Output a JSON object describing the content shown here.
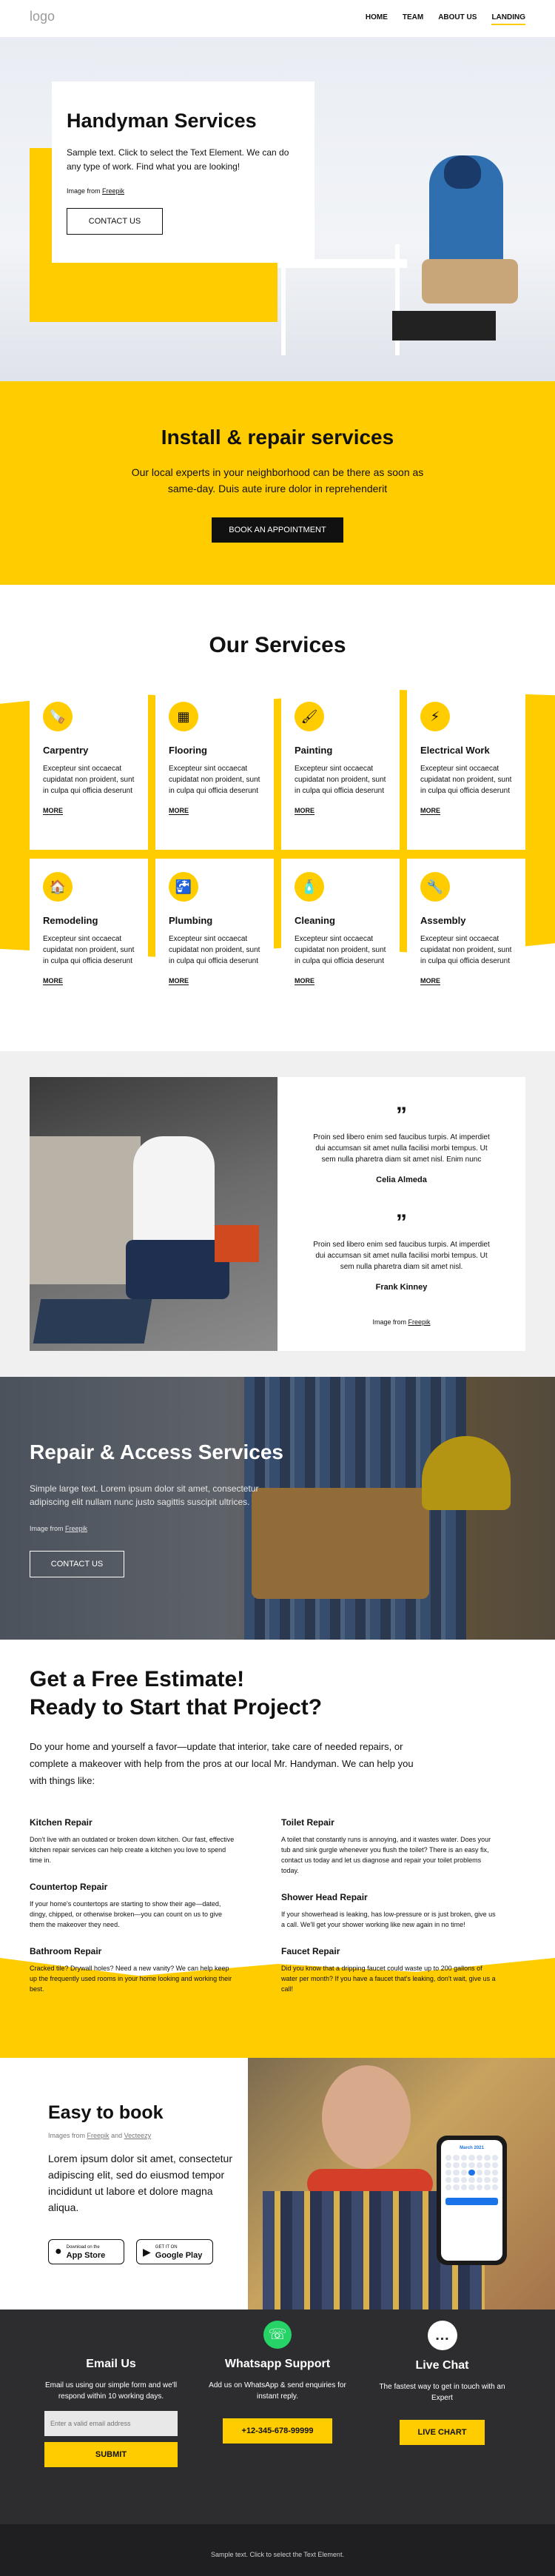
{
  "header": {
    "logo": "logo",
    "nav": [
      "HOME",
      "TEAM",
      "ABOUT US",
      "LANDING"
    ]
  },
  "hero": {
    "title": "Handyman Services",
    "text": "Sample text. Click to select the Text Element. We can do any type of work. Find what you are looking!",
    "image_from": "Image from",
    "freepik": "Freepik",
    "button": "CONTACT US"
  },
  "install": {
    "title": "Install & repair services",
    "text": "Our local experts in your neighborhood can be there as soon as same-day. Duis aute irure dolor in reprehenderit",
    "button": "BOOK AN APPOINTMENT"
  },
  "services": {
    "title": "Our Services",
    "desc": "Excepteur sint occaecat cupidatat non proident, sunt in culpa qui officia deserunt",
    "more": "MORE",
    "items": [
      {
        "name": "Carpentry",
        "icon": "saw-icon",
        "glyph": "🪚"
      },
      {
        "name": "Flooring",
        "icon": "tiles-icon",
        "glyph": "▦"
      },
      {
        "name": "Painting",
        "icon": "paint-roller-icon",
        "glyph": "🖌"
      },
      {
        "name": "Electrical Work",
        "icon": "drill-icon",
        "glyph": "⚡"
      },
      {
        "name": "Remodeling",
        "icon": "house-icon",
        "glyph": "🏠"
      },
      {
        "name": "Plumbing",
        "icon": "faucet-icon",
        "glyph": "🚰"
      },
      {
        "name": "Cleaning",
        "icon": "spray-bottle-icon",
        "glyph": "🧴"
      },
      {
        "name": "Assembly",
        "icon": "tools-icon",
        "glyph": "🔧"
      }
    ]
  },
  "testimonials": {
    "items": [
      {
        "quote": "Proin sed libero enim sed faucibus turpis. At imperdiet dui accumsan sit amet nulla facilisi morbi tempus. Ut sem nulla pharetra diam sit amet nisl. Enim nunc",
        "name": "Celia Almeda"
      },
      {
        "quote": "Proin sed libero enim sed faucibus turpis. At imperdiet dui accumsan sit amet nulla facilisi morbi tempus. Ut sem nulla pharetra diam sit amet nisl.",
        "name": "Frank Kinney"
      }
    ],
    "image_from": "Image from",
    "freepik": "Freepik"
  },
  "repair": {
    "title": "Repair & Access Services",
    "text": "Simple large text. Lorem ipsum dolor sit amet, consectetur adipiscing elit nullam nunc justo sagittis suscipit ultrices.",
    "image_from": "Image from",
    "freepik": "Freepik",
    "button": "CONTACT US"
  },
  "estimate": {
    "title1": "Get a Free Estimate!",
    "title2": "Ready to Start that Project?",
    "intro": "Do your home and yourself a favor—update that interior, take care of needed repairs, or complete a makeover with help from the pros at our local Mr. Handyman. We can help you with things like:",
    "left": [
      {
        "h": "Kitchen Repair",
        "t": "Don't live with an outdated or broken down kitchen. Our fast, effective kitchen repair services can help create a kitchen you love to spend time in."
      },
      {
        "h": "Countertop Repair",
        "t": "If your home's countertops are starting to show their age—dated, dingy, chipped, or otherwise broken—you can count on us to give them the makeover they need."
      },
      {
        "h": "Bathroom Repair",
        "t": "Cracked tile? Drywall holes? Need a new vanity? We can help keep up the frequently used rooms in your home looking and working their best."
      }
    ],
    "right": [
      {
        "h": "Toilet Repair",
        "t": "A toilet that constantly runs is annoying, and it wastes water. Does your tub and sink gurgle whenever you flush the toilet? There is an easy fix, contact us today and let us diagnose and repair your toilet problems today."
      },
      {
        "h": "Shower Head Repair",
        "t": "If your showerhead is leaking, has low-pressure or is just broken, give us a call. We'll get your shower working like new again in no time!"
      },
      {
        "h": "Faucet Repair",
        "t": "Did you know that a dripping faucet could waste up to 200 gallons of water per month? If you have a faucet that's leaking, don't wait, give us a call!"
      }
    ]
  },
  "book": {
    "title": "Easy to book",
    "images_from": "Images from",
    "freepik": "Freepik",
    "and": "and",
    "vecteezy": "Vecteezy",
    "text": "Lorem ipsum dolor sit amet, consectetur adipiscing elit, sed do eiusmod tempor incididunt ut labore et dolore magna aliqua.",
    "appstore_small": "Download on the",
    "appstore": "App Store",
    "gplay_small": "GET IT ON",
    "gplay": "Google Play",
    "phone_month": "March 2021"
  },
  "contact": [
    {
      "title": "Email Us",
      "text": "Email us using our simple form and we'll respond within 10 working days.",
      "placeholder": "Enter a valid email address",
      "button": "SUBMIT"
    },
    {
      "title": "Whatsapp Support",
      "text": "Add us on WhatsApp & send enquiries for instant reply.",
      "button": "+12-345-678-99999"
    },
    {
      "title": "Live Chat",
      "text": "The fastest way to get in touch with an Expert",
      "button": "LIVE CHART"
    }
  ],
  "footer": {
    "text": "Sample text. Click to select the Text Element."
  },
  "colors": {
    "accent": "#ffcc00",
    "dark": "#2d2d30",
    "footer": "#1f1f22"
  }
}
